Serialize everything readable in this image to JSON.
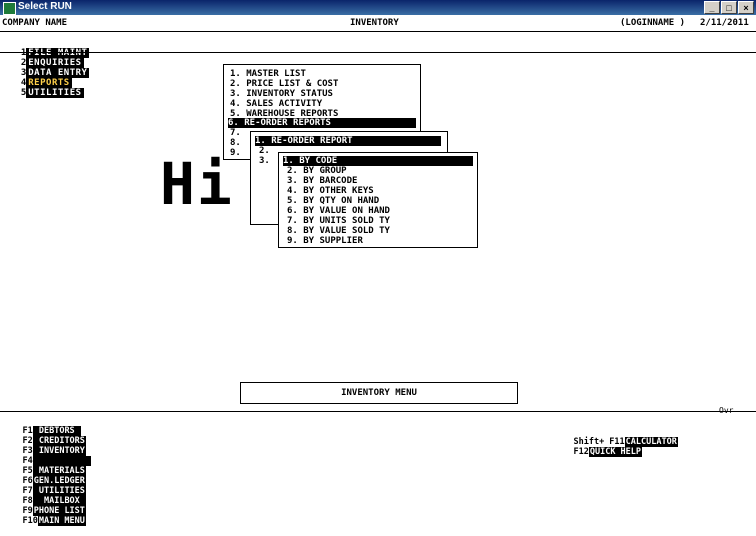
{
  "window": {
    "title": "Select RUN",
    "min": "_",
    "max": "□",
    "close": "×"
  },
  "header": {
    "company": "COMPANY NAME",
    "module": "INVENTORY",
    "login": "(LOGINNAME )",
    "date": "2/11/2011"
  },
  "menubar": [
    {
      "num": "1",
      "label": "FILE MAINT"
    },
    {
      "num": "2",
      "label": "ENQUIRIES"
    },
    {
      "num": "3",
      "label": "DATA ENTRY"
    },
    {
      "num": "4",
      "label": "REPORTS",
      "active": true
    },
    {
      "num": "5",
      "label": "UTILITIES"
    }
  ],
  "background_text": "Hi          CE",
  "reports_menu": [
    "1. MASTER LIST",
    "2. PRICE LIST & COST",
    "3. INVENTORY STATUS",
    "4. SALES ACTIVITY",
    "5. WAREHOUSE REPORTS",
    "6. RE-ORDER REPORTS",
    "7.",
    "8.",
    "9."
  ],
  "reorder_menu": [
    "1. RE-ORDER REPORT",
    "2.",
    "3."
  ],
  "reorder_sub": [
    "1. BY CODE",
    "2. BY GROUP",
    "3. BY BARCODE",
    "4. BY OTHER KEYS",
    "5. BY QTY ON HAND",
    "6. BY VALUE ON HAND",
    "7. BY UNITS SOLD TY",
    "8. BY VALUE SOLD TY",
    "9. BY SUPPLIER"
  ],
  "footer_title": "INVENTORY MENU",
  "ovr": "Ovr",
  "fkeys": [
    {
      "key": "F1",
      "label": " DEBTORS "
    },
    {
      "key": "F2",
      "label": " CREDITORS"
    },
    {
      "key": "F3",
      "label": " INVENTORY"
    },
    {
      "key": "F4",
      "label": "           "
    },
    {
      "key": "F5",
      "label": " MATERIALS"
    },
    {
      "key": "F6",
      "label": "GEN.LEDGER"
    },
    {
      "key": "F7",
      "label": " UTILITIES"
    },
    {
      "key": "F8",
      "label": "  MAILBOX "
    },
    {
      "key": "F9",
      "label": "PHONE LIST"
    },
    {
      "key": "F10",
      "label": "MAIN MENU"
    }
  ],
  "fkeys2": [
    {
      "key": "Shift+ F11",
      "label": "CALCULATOR"
    },
    {
      "key": "F12",
      "label": "QUICK HELP"
    }
  ]
}
